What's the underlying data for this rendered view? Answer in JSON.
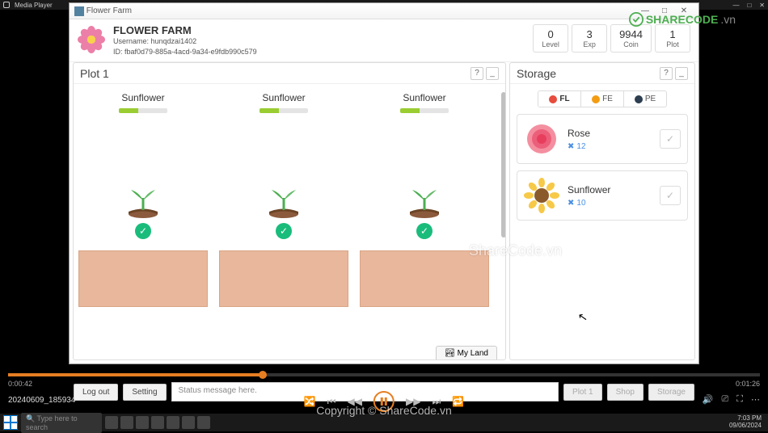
{
  "os": {
    "player_label": "Media Player"
  },
  "player": {
    "time_current": "0:00:42",
    "time_total": "0:01:26",
    "recording_name": "20240609_185934"
  },
  "window": {
    "title": "Flower Farm"
  },
  "header": {
    "title": "FLOWER FARM",
    "username_label": "Username:",
    "username": "hunqdzai1402",
    "id_label": "ID:",
    "id": "fbaf0d79-885a-4acd-9a34-e9fdb990c579"
  },
  "stats": [
    {
      "value": "0",
      "label": "Level"
    },
    {
      "value": "3",
      "label": "Exp"
    },
    {
      "value": "9944",
      "label": "Coin"
    },
    {
      "value": "1",
      "label": "Plot"
    }
  ],
  "plot_panel": {
    "title": "Plot 1",
    "help": "?",
    "minimize": "_",
    "plants": [
      {
        "name": "Sunflower",
        "progress": 40
      },
      {
        "name": "Sunflower",
        "progress": 40
      },
      {
        "name": "Sunflower",
        "progress": 40
      }
    ],
    "myland": "My Land"
  },
  "storage_panel": {
    "title": "Storage",
    "help": "?",
    "minimize": "_",
    "tabs": [
      {
        "key": "FL",
        "active": true
      },
      {
        "key": "FE",
        "active": false
      },
      {
        "key": "PE",
        "active": false
      }
    ],
    "items": [
      {
        "name": "Rose",
        "qty": "12"
      },
      {
        "name": "Sunflower",
        "qty": "10"
      }
    ]
  },
  "bottom": {
    "logout": "Log out",
    "setting": "Setting",
    "status": "Status message here.",
    "plot1": "Plot 1",
    "shop": "Shop",
    "storage": "Storage"
  },
  "taskbar": {
    "search_placeholder": "Type here to search",
    "time": "7:03 PM",
    "date": "09/06/2024"
  },
  "watermark": {
    "center": "ShareCode.vn",
    "bottom": "Copyright © ShareCode.vn",
    "logo_a": "SHARECODE",
    "logo_b": ".vn"
  }
}
